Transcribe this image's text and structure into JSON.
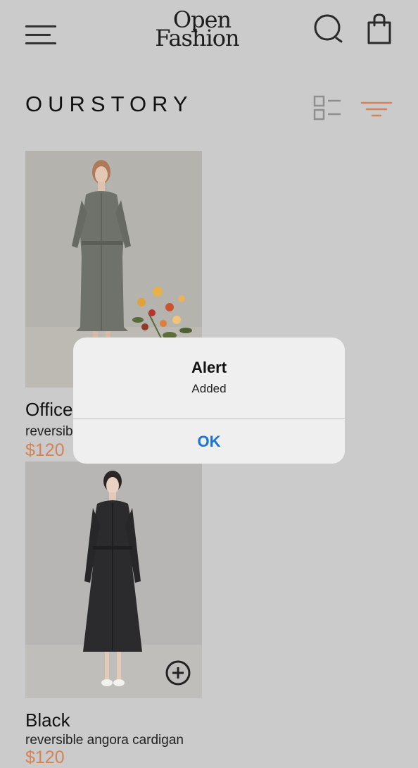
{
  "header": {
    "logo_line1": "Open",
    "logo_line2": "Fashion",
    "menu_icon": "hamburger-menu-icon",
    "search_icon": "search-icon",
    "cart_icon": "shopping-bag-icon"
  },
  "section": {
    "title": "OURSTORY",
    "view_icon": "list-view-icon",
    "filter_icon": "filter-icon"
  },
  "products": [
    {
      "name": "Office",
      "description": "reversible",
      "price": "$120",
      "image_icon": "dress-photo-olive"
    },
    {
      "name": "Black",
      "description": "reversible angora cardigan",
      "price": "$120",
      "image_icon": "dress-photo-black",
      "add_icon": "plus-circle-icon"
    }
  ],
  "alert": {
    "title": "Alert",
    "message": "Added",
    "ok_label": "OK"
  },
  "colors": {
    "background": "#cbcbcb",
    "accent": "#d48357",
    "alert_button": "#1a73d9"
  }
}
